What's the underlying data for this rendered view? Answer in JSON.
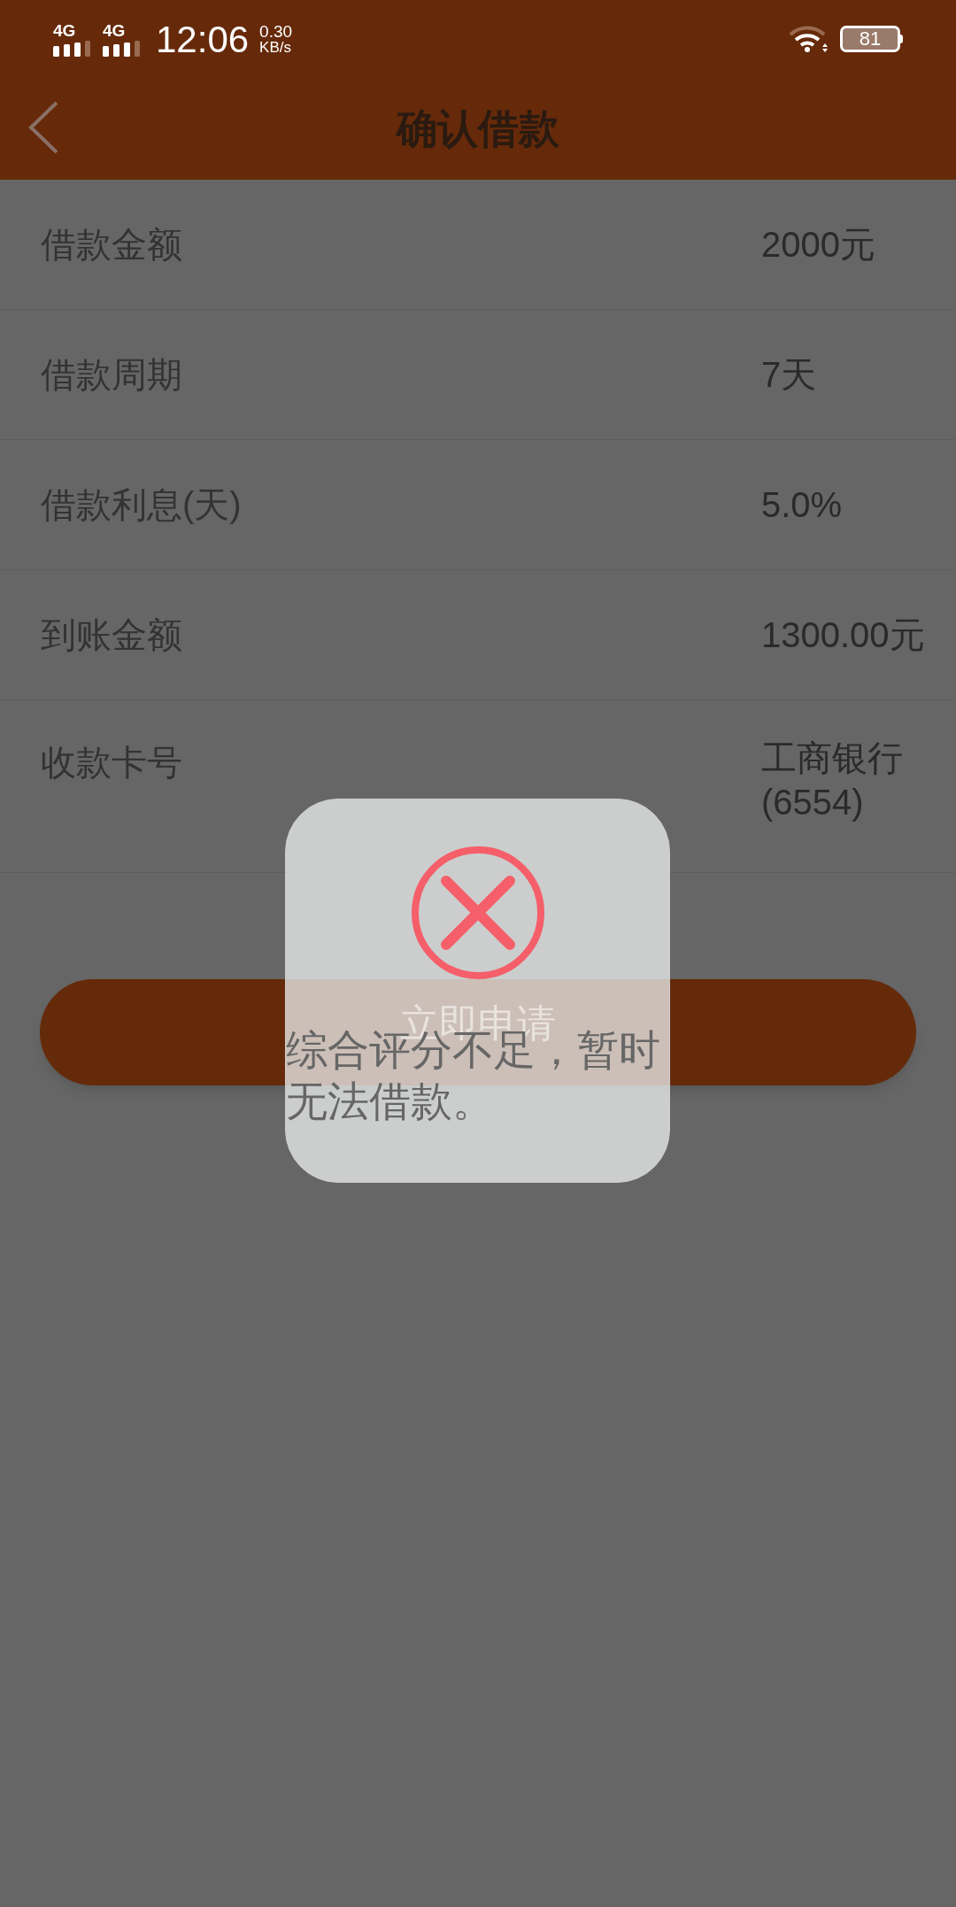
{
  "status_bar": {
    "signals": [
      {
        "label": "4G"
      },
      {
        "label": "4G"
      }
    ],
    "time": "12:06",
    "speed": "0.30",
    "speed_unit": "KB/s",
    "battery": "81"
  },
  "header": {
    "title": "确认借款"
  },
  "rows": [
    {
      "label": "借款金额",
      "value": "2000元"
    },
    {
      "label": "借款周期",
      "value": "7天"
    },
    {
      "label": "借款利息(天)",
      "value": "5.0%"
    },
    {
      "label": "到账金额",
      "value": "1300.00元"
    },
    {
      "label": "收款卡号",
      "value": "工商银行 (6554)"
    }
  ],
  "button": {
    "label": "立即申请"
  },
  "dialog": {
    "message": "综合评分不足，暂时无法借款。"
  }
}
